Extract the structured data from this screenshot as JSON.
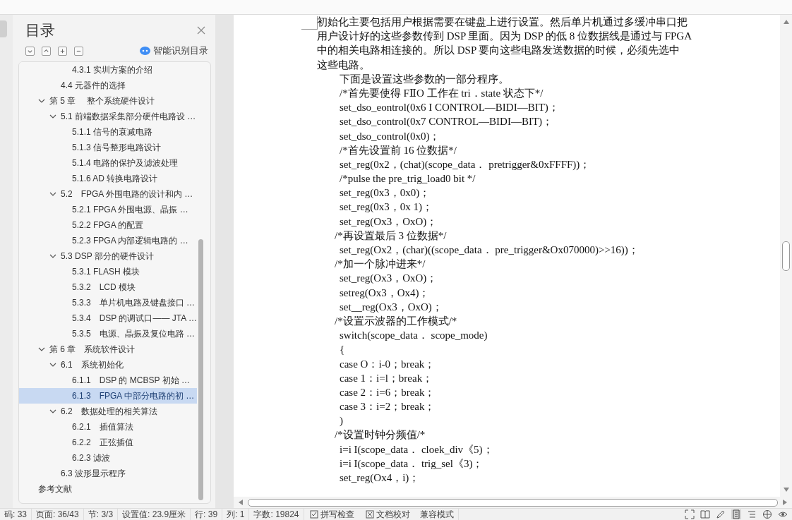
{
  "toc_panel": {
    "title": "目录",
    "smart_button": "智能识别目录",
    "items": [
      {
        "children": [
          {
            "children": [
              {
                "label": "4.3.1 实圳方案的介绍",
                "selected": false
              }
            ]
          },
          {
            "label": "4.4 元器件的选择",
            "selected": false
          }
        ]
      },
      {
        "label": "第 5 章　 整个系统硬件设计",
        "expanded": true,
        "selected": false,
        "children": [
          {
            "label": "5.1 前端数据采集部分硬件电路设 …",
            "expanded": true,
            "selected": false,
            "children": [
              {
                "label": "5.1.1 信号的衰减电路",
                "selected": false
              },
              {
                "label": "5.1.3  信号整形电路设计",
                "selected": false
              },
              {
                "label": "5.1.4  电路的保护及滤波处理",
                "selected": false
              },
              {
                "label": "5.1.6 AD 转换电路设计",
                "selected": false
              }
            ]
          },
          {
            "label": "5.2　FPGA 外围电路的设计和内 …",
            "expanded": true,
            "selected": false,
            "children": [
              {
                "label": "5.2.1 FPGA 外围电源、晶振 …",
                "selected": false
              },
              {
                "label": "5.2.2 FPGA 的配置",
                "selected": false
              },
              {
                "label": "5.2.3 FPGA 内部逻辑电路的 …",
                "selected": false
              }
            ]
          },
          {
            "label": "5.3 DSP 部分的硬件设计",
            "expanded": true,
            "selected": false,
            "children": [
              {
                "label": "5.3.1 FLASH 模块",
                "selected": false
              },
              {
                "label": "5.3.2　LCD 模块",
                "selected": false
              },
              {
                "label": "5.3.3　单片机电路及键盘接口 …",
                "selected": false
              },
              {
                "label": "5.3.4　DSP 的调试口—— JTA …",
                "selected": false
              },
              {
                "label": "5.3.5　电源、晶振及复位电路 …",
                "selected": false
              }
            ]
          }
        ]
      },
      {
        "label": "第 6 章　系统软件设计",
        "expanded": true,
        "selected": false,
        "children": [
          {
            "label": "6.1　系统初始化",
            "expanded": true,
            "selected": false,
            "children": [
              {
                "label": "6.1.1　DSP 的 MCBSP 初始 …",
                "selected": false
              },
              {
                "label": "6.1.3　FPGA 中部分电路的初 …",
                "selected": true
              }
            ]
          },
          {
            "label": "6.2　数据处理的相关算法",
            "expanded": true,
            "selected": false,
            "children": [
              {
                "label": "6.2.1　插值算法",
                "selected": false
              },
              {
                "label": "6.2.2　正弦插值",
                "selected": false
              },
              {
                "label": "6.2.3  滤波",
                "selected": false
              }
            ]
          },
          {
            "label": "6.3 波形显示程序",
            "selected": false
          }
        ]
      },
      {
        "label": "参考文献",
        "selected": false
      }
    ]
  },
  "document": {
    "lines": [
      {
        "kind": "para",
        "text": "初始化主要包括用户根据需要在键盘上进行设置。然后单片机通过多缓冲串口把"
      },
      {
        "kind": "para",
        "text": "用户设计好的这些参数传到 DSP 里面。因为 DSP 的低 8 位数据线是通过与 FPGA"
      },
      {
        "kind": "para",
        "text": "中的相关电路相连接的。所以 DSP 要向这些电路发送数据的时候，必须先选中"
      },
      {
        "kind": "para",
        "text": "这些电路。"
      },
      {
        "kind": "code",
        "text": "下面是设置这些参数的一部分程序。"
      },
      {
        "kind": "code",
        "text": "/*首先要使得 FⅡO 工作在 tri．state 状态下*/"
      },
      {
        "kind": "code",
        "text": "set_dso_eontrol(0x6 I CONTROL—BIDI—BIT)；"
      },
      {
        "kind": "code",
        "text": "set_dso_control(0x7 CONTROL—BIDI—BIT)；"
      },
      {
        "kind": "code",
        "text": "set_dso_control(0x0)；"
      },
      {
        "kind": "code",
        "text": "/*首先设置前 16 位数据*/"
      },
      {
        "kind": "code",
        "text": "set_reg(0x2，(chat)(scope_data． pretrigger&0xFFFF))；"
      },
      {
        "kind": "code",
        "text": "/*pulse the pre_trig_load0 bit */"
      },
      {
        "kind": "code",
        "text": "set_reg(0x3，0x0)；"
      },
      {
        "kind": "code",
        "text": "set_reg(0x3，0x 1)；"
      },
      {
        "kind": "code",
        "text": "set_reg(Ox3，OxO)；"
      },
      {
        "kind": "comment",
        "text": "/*再设置最后 3 位数据*/"
      },
      {
        "kind": "code",
        "text": "set_reg(Ox2，(char)((scope_data． pre_trigger&Ox070000)>>16))；"
      },
      {
        "kind": "comment",
        "text": "/*加一个脉冲进来*/"
      },
      {
        "kind": "code",
        "text": "set_reg(Ox3，OxO)；"
      },
      {
        "kind": "code",
        "text": "setreg(Ox3，Ox4)；"
      },
      {
        "kind": "code",
        "text": "set__reg(Ox3，OxO)；"
      },
      {
        "kind": "comment",
        "text": "/*设置示波器的工作模式/*"
      },
      {
        "kind": "code",
        "text": "switch(scope_data． scope_mode)"
      },
      {
        "kind": "code",
        "text": "{"
      },
      {
        "kind": "code",
        "text": "case O：i-0；break；"
      },
      {
        "kind": "code",
        "text": "case 1：i=l；break；"
      },
      {
        "kind": "code",
        "text": "case 2：i=6；break；"
      },
      {
        "kind": "code",
        "text": "case 3：i=2；break；"
      },
      {
        "kind": "code",
        "text": ")"
      },
      {
        "kind": "comment",
        "text": "/*设置时钟分频值/*"
      },
      {
        "kind": "code",
        "text": "i=i I(scope_data． cloek_div《5)；"
      },
      {
        "kind": "code",
        "text": "i=i I(scope_data． trig_sel《3)；"
      },
      {
        "kind": "code",
        "text": "set_reg(Ox4，i)；"
      }
    ]
  },
  "status_bar": {
    "items": [
      "码: 33",
      "页面: 36/43",
      "节: 3/3",
      "设置值: 23.9厘米",
      "行: 39",
      "列: 1",
      "字数: 19824"
    ],
    "spell_check": "拼写检查",
    "proofread": "文档校对",
    "compat_mode": "兼容模式"
  }
}
